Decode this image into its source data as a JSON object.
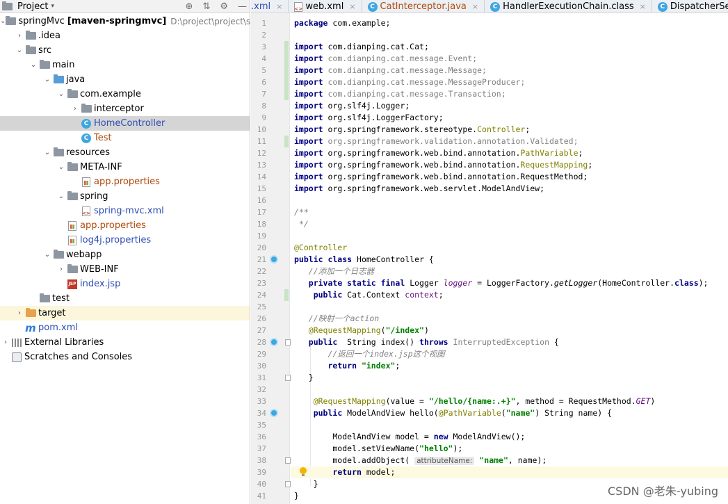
{
  "project_panel": {
    "title": "Project",
    "tree": [
      {
        "label": "springMvc",
        "bold_suffix": "[maven-springmvc]",
        "path": "D:\\project\\project\\sprin",
        "arrow": "▾",
        "icon": "folder",
        "depth": 0
      },
      {
        "label": ".idea",
        "arrow": "▸",
        "icon": "folder",
        "depth": 1
      },
      {
        "label": "src",
        "arrow": "▾",
        "icon": "folder",
        "depth": 1
      },
      {
        "label": "main",
        "arrow": "▾",
        "icon": "folder",
        "depth": 2
      },
      {
        "label": "java",
        "arrow": "▾",
        "icon": "folder-blue",
        "depth": 3
      },
      {
        "label": "com.example",
        "arrow": "▾",
        "icon": "folder",
        "depth": 4
      },
      {
        "label": "interceptor",
        "arrow": "▸",
        "icon": "folder",
        "depth": 5
      },
      {
        "label": "HomeController",
        "arrow": "",
        "icon": "class",
        "depth": 5,
        "selected": true,
        "color": "blue"
      },
      {
        "label": "Test",
        "arrow": "",
        "icon": "class",
        "depth": 5,
        "color": "orange"
      },
      {
        "label": "resources",
        "arrow": "▾",
        "icon": "folder",
        "depth": 3
      },
      {
        "label": "META-INF",
        "arrow": "▾",
        "icon": "folder",
        "depth": 4
      },
      {
        "label": "app.properties",
        "arrow": "",
        "icon": "props",
        "depth": 5,
        "color": "orange"
      },
      {
        "label": "spring",
        "arrow": "▾",
        "icon": "folder",
        "depth": 4
      },
      {
        "label": "spring-mvc.xml",
        "arrow": "",
        "icon": "xml",
        "depth": 5,
        "color": "blue"
      },
      {
        "label": "app.properties",
        "arrow": "",
        "icon": "props",
        "depth": 4,
        "color": "orange"
      },
      {
        "label": "log4j.properties",
        "arrow": "",
        "icon": "props",
        "depth": 4,
        "color": "blue"
      },
      {
        "label": "webapp",
        "arrow": "▾",
        "icon": "folder",
        "depth": 3
      },
      {
        "label": "WEB-INF",
        "arrow": "▸",
        "icon": "folder",
        "depth": 4
      },
      {
        "label": "index.jsp",
        "arrow": "",
        "icon": "jsp",
        "depth": 4,
        "color": "blue"
      },
      {
        "label": "test",
        "arrow": "",
        "icon": "folder",
        "depth": 2
      },
      {
        "label": "target",
        "arrow": "▸",
        "icon": "folder-orange",
        "depth": 1,
        "excluded": true
      },
      {
        "label": "pom.xml",
        "arrow": "",
        "icon": "maven",
        "depth": 1,
        "color": "blue"
      },
      {
        "label": "External Libraries",
        "arrow": "▸",
        "icon": "lib",
        "depth": 0
      },
      {
        "label": "Scratches and Consoles",
        "arrow": "",
        "icon": "scratch",
        "depth": 0
      }
    ]
  },
  "tabs": [
    {
      "label": ".xml",
      "icon": "none"
    },
    {
      "label": "web.xml",
      "icon": "xml"
    },
    {
      "label": "CatInterceptor.java",
      "icon": "class",
      "color": "#b1480d"
    },
    {
      "label": "HandlerExecutionChain.class",
      "icon": "class"
    },
    {
      "label": "DispatcherServlet.class",
      "icon": "class"
    }
  ],
  "code_lines": [
    {
      "n": "1",
      "html": "<span class='kw'>package</span> com.example;"
    },
    {
      "n": "2",
      "html": ""
    },
    {
      "n": "3",
      "html": "<span class='kw'>import</span> com.dianping.cat.Cat;"
    },
    {
      "n": "4",
      "html": "<span class='kw'>import</span> <span class='gray'>com.dianping.cat.message.Event;</span>"
    },
    {
      "n": "5",
      "html": "<span class='kw'>import</span> <span class='gray'>com.dianping.cat.message.Message;</span>"
    },
    {
      "n": "6",
      "html": "<span class='kw'>import</span> <span class='gray'>com.dianping.cat.message.MessageProducer;</span>"
    },
    {
      "n": "7",
      "html": "<span class='kw'>import</span> <span class='gray'>com.dianping.cat.message.Transaction;</span>"
    },
    {
      "n": "8",
      "html": "<span class='kw'>import</span> org.slf4j.Logger;"
    },
    {
      "n": "9",
      "html": "<span class='kw'>import</span> org.slf4j.LoggerFactory;"
    },
    {
      "n": "10",
      "html": "<span class='kw'>import</span> org.springframework.stereotype.<span class='ann'>Controller</span>;"
    },
    {
      "n": "11",
      "html": "<span class='kw'>import</span> <span class='gray'>org.springframework.validation.annotation.Validated;</span>"
    },
    {
      "n": "12",
      "html": "<span class='kw'>import</span> org.springframework.web.bind.annotation.<span class='ann'>PathVariable</span>;"
    },
    {
      "n": "13",
      "html": "<span class='kw'>import</span> org.springframework.web.bind.annotation.<span class='ann'>RequestMapping</span>;"
    },
    {
      "n": "14",
      "html": "<span class='kw'>import</span> org.springframework.web.bind.annotation.RequestMethod;"
    },
    {
      "n": "15",
      "html": "<span class='kw'>import</span> org.springframework.web.servlet.ModelAndView;"
    },
    {
      "n": "16",
      "html": ""
    },
    {
      "n": "17",
      "html": "<span class='cmt'>/**</span>"
    },
    {
      "n": "18",
      "html": "<span class='cmt'> */</span>"
    },
    {
      "n": "19",
      "html": ""
    },
    {
      "n": "20",
      "html": "<span class='ann'>@Controller</span>"
    },
    {
      "n": "21",
      "html": "<span class='kw'>public class</span> HomeController {"
    },
    {
      "n": "22",
      "html": "   <span class='cmt'>//添加一个日志器</span>"
    },
    {
      "n": "23",
      "html": "   <span class='kw'>private static final</span> Logger <span class='field ital'>logger</span> = LoggerFactory.<span class='ital'>getLogger</span>(HomeController.<span class='kw'>class</span>);"
    },
    {
      "n": "24",
      "html": "    <span class='kw'>public</span> Cat.Context <span class='field'>context</span>;"
    },
    {
      "n": "25",
      "html": ""
    },
    {
      "n": "26",
      "html": "   <span class='cmt'>//映射一个action</span>"
    },
    {
      "n": "27",
      "html": "   <span class='ann'>@RequestMapping</span>(<span class='str'>\"/index\"</span>)"
    },
    {
      "n": "28",
      "html": "   <span class='kw'>public</span>  String index() <span class='kw'>throws</span> <span class='gray'>InterruptedException</span> {"
    },
    {
      "n": "29",
      "html": "       <span class='cmt'>//返回一个index.jsp这个视图</span>"
    },
    {
      "n": "30",
      "html": "       <span class='kw'>return</span> <span class='str'>\"index\"</span>;"
    },
    {
      "n": "31",
      "html": "   }"
    },
    {
      "n": "32",
      "html": ""
    },
    {
      "n": "33",
      "html": "    <span class='ann'>@RequestMapping</span>(value = <span class='str'>\"/hello/{name:.+}\"</span>, method = RequestMethod.<span class='field ital'>GET</span>)"
    },
    {
      "n": "34",
      "html": "    <span class='kw'>public</span> ModelAndView hello(<span class='ann'>@PathVariable</span>(<span class='str'>\"name\"</span>) String name) {"
    },
    {
      "n": "35",
      "html": ""
    },
    {
      "n": "36",
      "html": "        ModelAndView model = <span class='kw'>new</span> ModelAndView();"
    },
    {
      "n": "37",
      "html": "        model.setViewName(<span class='str'>\"hello\"</span>);"
    },
    {
      "n": "38",
      "html": "        model.addObject( <span class='hintbox'>attributeName:</span> <span class='str'>\"name\"</span>, name);"
    },
    {
      "n": "39",
      "html": "        <span class='kw'>return</span> model;"
    },
    {
      "n": "40",
      "html": "    }"
    },
    {
      "n": "41",
      "html": "}"
    }
  ],
  "watermark": "CSDN @老朱-yubing"
}
